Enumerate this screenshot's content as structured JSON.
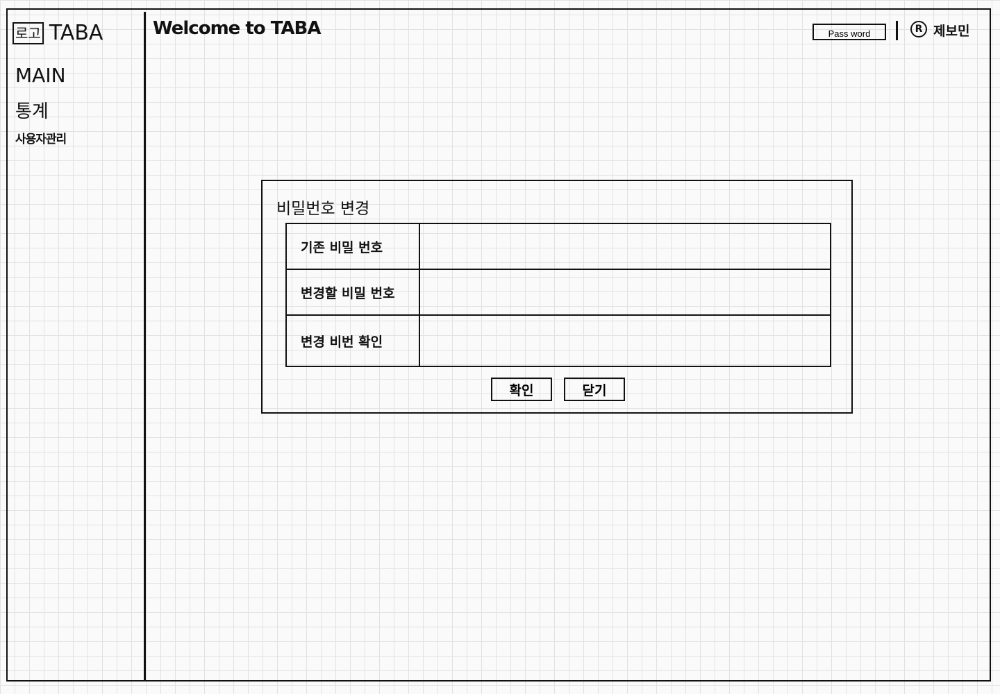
{
  "logo": {
    "box": "로고",
    "title": "TABA"
  },
  "sidebar": {
    "items": [
      {
        "label": "MAIN"
      },
      {
        "label": "통계"
      },
      {
        "label": "사용자관리"
      }
    ]
  },
  "header": {
    "welcome": "Welcome to TABA",
    "password_button": "Pass word",
    "user_icon": "R",
    "user_name": "제보민"
  },
  "modal": {
    "title": "비밀번호 변경",
    "fields": [
      {
        "label": "기존 비밀 번호",
        "value": ""
      },
      {
        "label": "변경할 비밀 번호",
        "value": ""
      },
      {
        "label": "변경 비번 확인",
        "value": ""
      }
    ],
    "confirm": "확인",
    "close": "닫기"
  }
}
